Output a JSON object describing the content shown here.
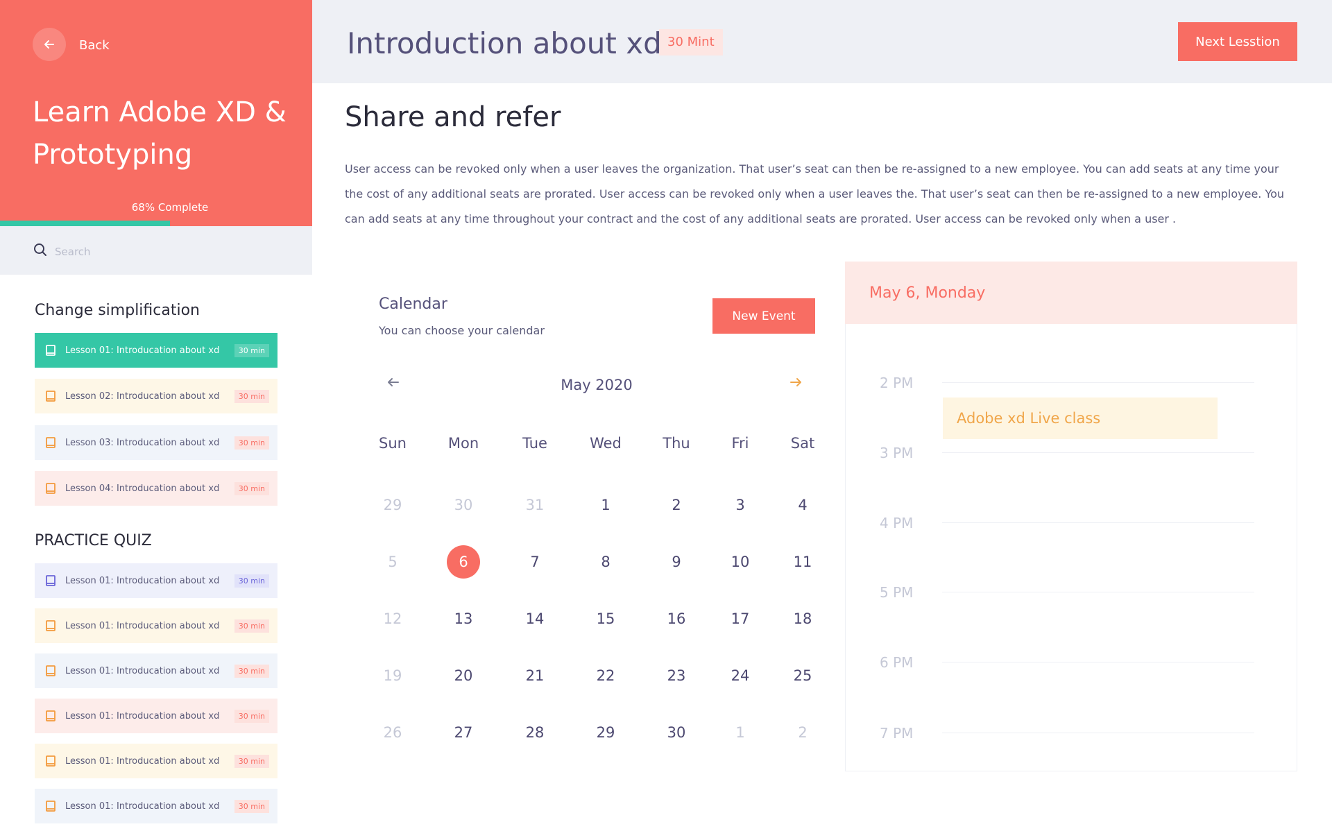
{
  "sidebar": {
    "back_label": "Back",
    "course_title": "Learn Adobe XD & Prototyping",
    "progress_label": "68% Complete",
    "progress_value": 0.545,
    "search_placeholder": "Search",
    "section1_title": "Change simplification",
    "section1_lessons": [
      {
        "label": "Lesson 01: Introducation about xd",
        "duration": "30 min"
      },
      {
        "label": "Lesson 02: Introducation about xd",
        "duration": "30 min"
      },
      {
        "label": "Lesson 03: Introducation about xd",
        "duration": "30 min"
      },
      {
        "label": "Lesson 04: Introducation about xd",
        "duration": "30 min"
      }
    ],
    "section2_title": "PRACTICE QUIZ",
    "section2_lessons": [
      {
        "label": "Lesson 01: Introducation about xd",
        "duration": "30 min"
      },
      {
        "label": "Lesson 01: Introducation about xd",
        "duration": "30 min"
      },
      {
        "label": "Lesson 01: Introducation about xd",
        "duration": "30 min"
      },
      {
        "label": "Lesson 01: Introducation about xd",
        "duration": "30 min"
      },
      {
        "label": "Lesson 01: Introducation about xd",
        "duration": "30 min"
      },
      {
        "label": "Lesson 01: Introducation about xd",
        "duration": "30 min"
      }
    ]
  },
  "header": {
    "lesson_title": "Introduction about xd",
    "duration_badge": "30 Mint",
    "next_button": "Next Lesstion"
  },
  "content": {
    "heading": "Share and refer",
    "body": "User access can be revoked only when a user leaves the organization. That user’s seat can then be re-assigned to a new employee. You can add seats at any time your the cost of any additional seats are prorated. User access can be revoked only when a user leaves the. That user’s seat can then be re-assigned to a new employee. You can add seats at any time throughout your contract and the cost of any additional seats are prorated. User access can be revoked only when a user ."
  },
  "calendar": {
    "title": "Calendar",
    "subtitle": "You can choose your calendar",
    "new_event_button": "New Event",
    "month_label": "May 2020",
    "weekdays": [
      "Sun",
      "Mon",
      "Tue",
      "Wed",
      "Thu",
      "Fri",
      "Sat"
    ],
    "weeks": [
      [
        "29",
        "30",
        "31",
        "1",
        "2",
        "3",
        "4"
      ],
      [
        "5",
        "6",
        "7",
        "8",
        "9",
        "10",
        "11"
      ],
      [
        "12",
        "13",
        "14",
        "15",
        "16",
        "17",
        "18"
      ],
      [
        "19",
        "20",
        "21",
        "22",
        "23",
        "24",
        "25"
      ],
      [
        "26",
        "27",
        "28",
        "29",
        "30",
        "1",
        "2"
      ]
    ],
    "selected_day": "6"
  },
  "schedule": {
    "date_label": "May 6, Monday",
    "hours": [
      "2 PM",
      "3 PM",
      "4 PM",
      "5 PM",
      "6 PM",
      "7 PM"
    ],
    "event_label": "Adobe xd Live class"
  },
  "colors": {
    "accent": "#f86d63",
    "success": "#34c7a6",
    "text_primary": "#55517a"
  }
}
